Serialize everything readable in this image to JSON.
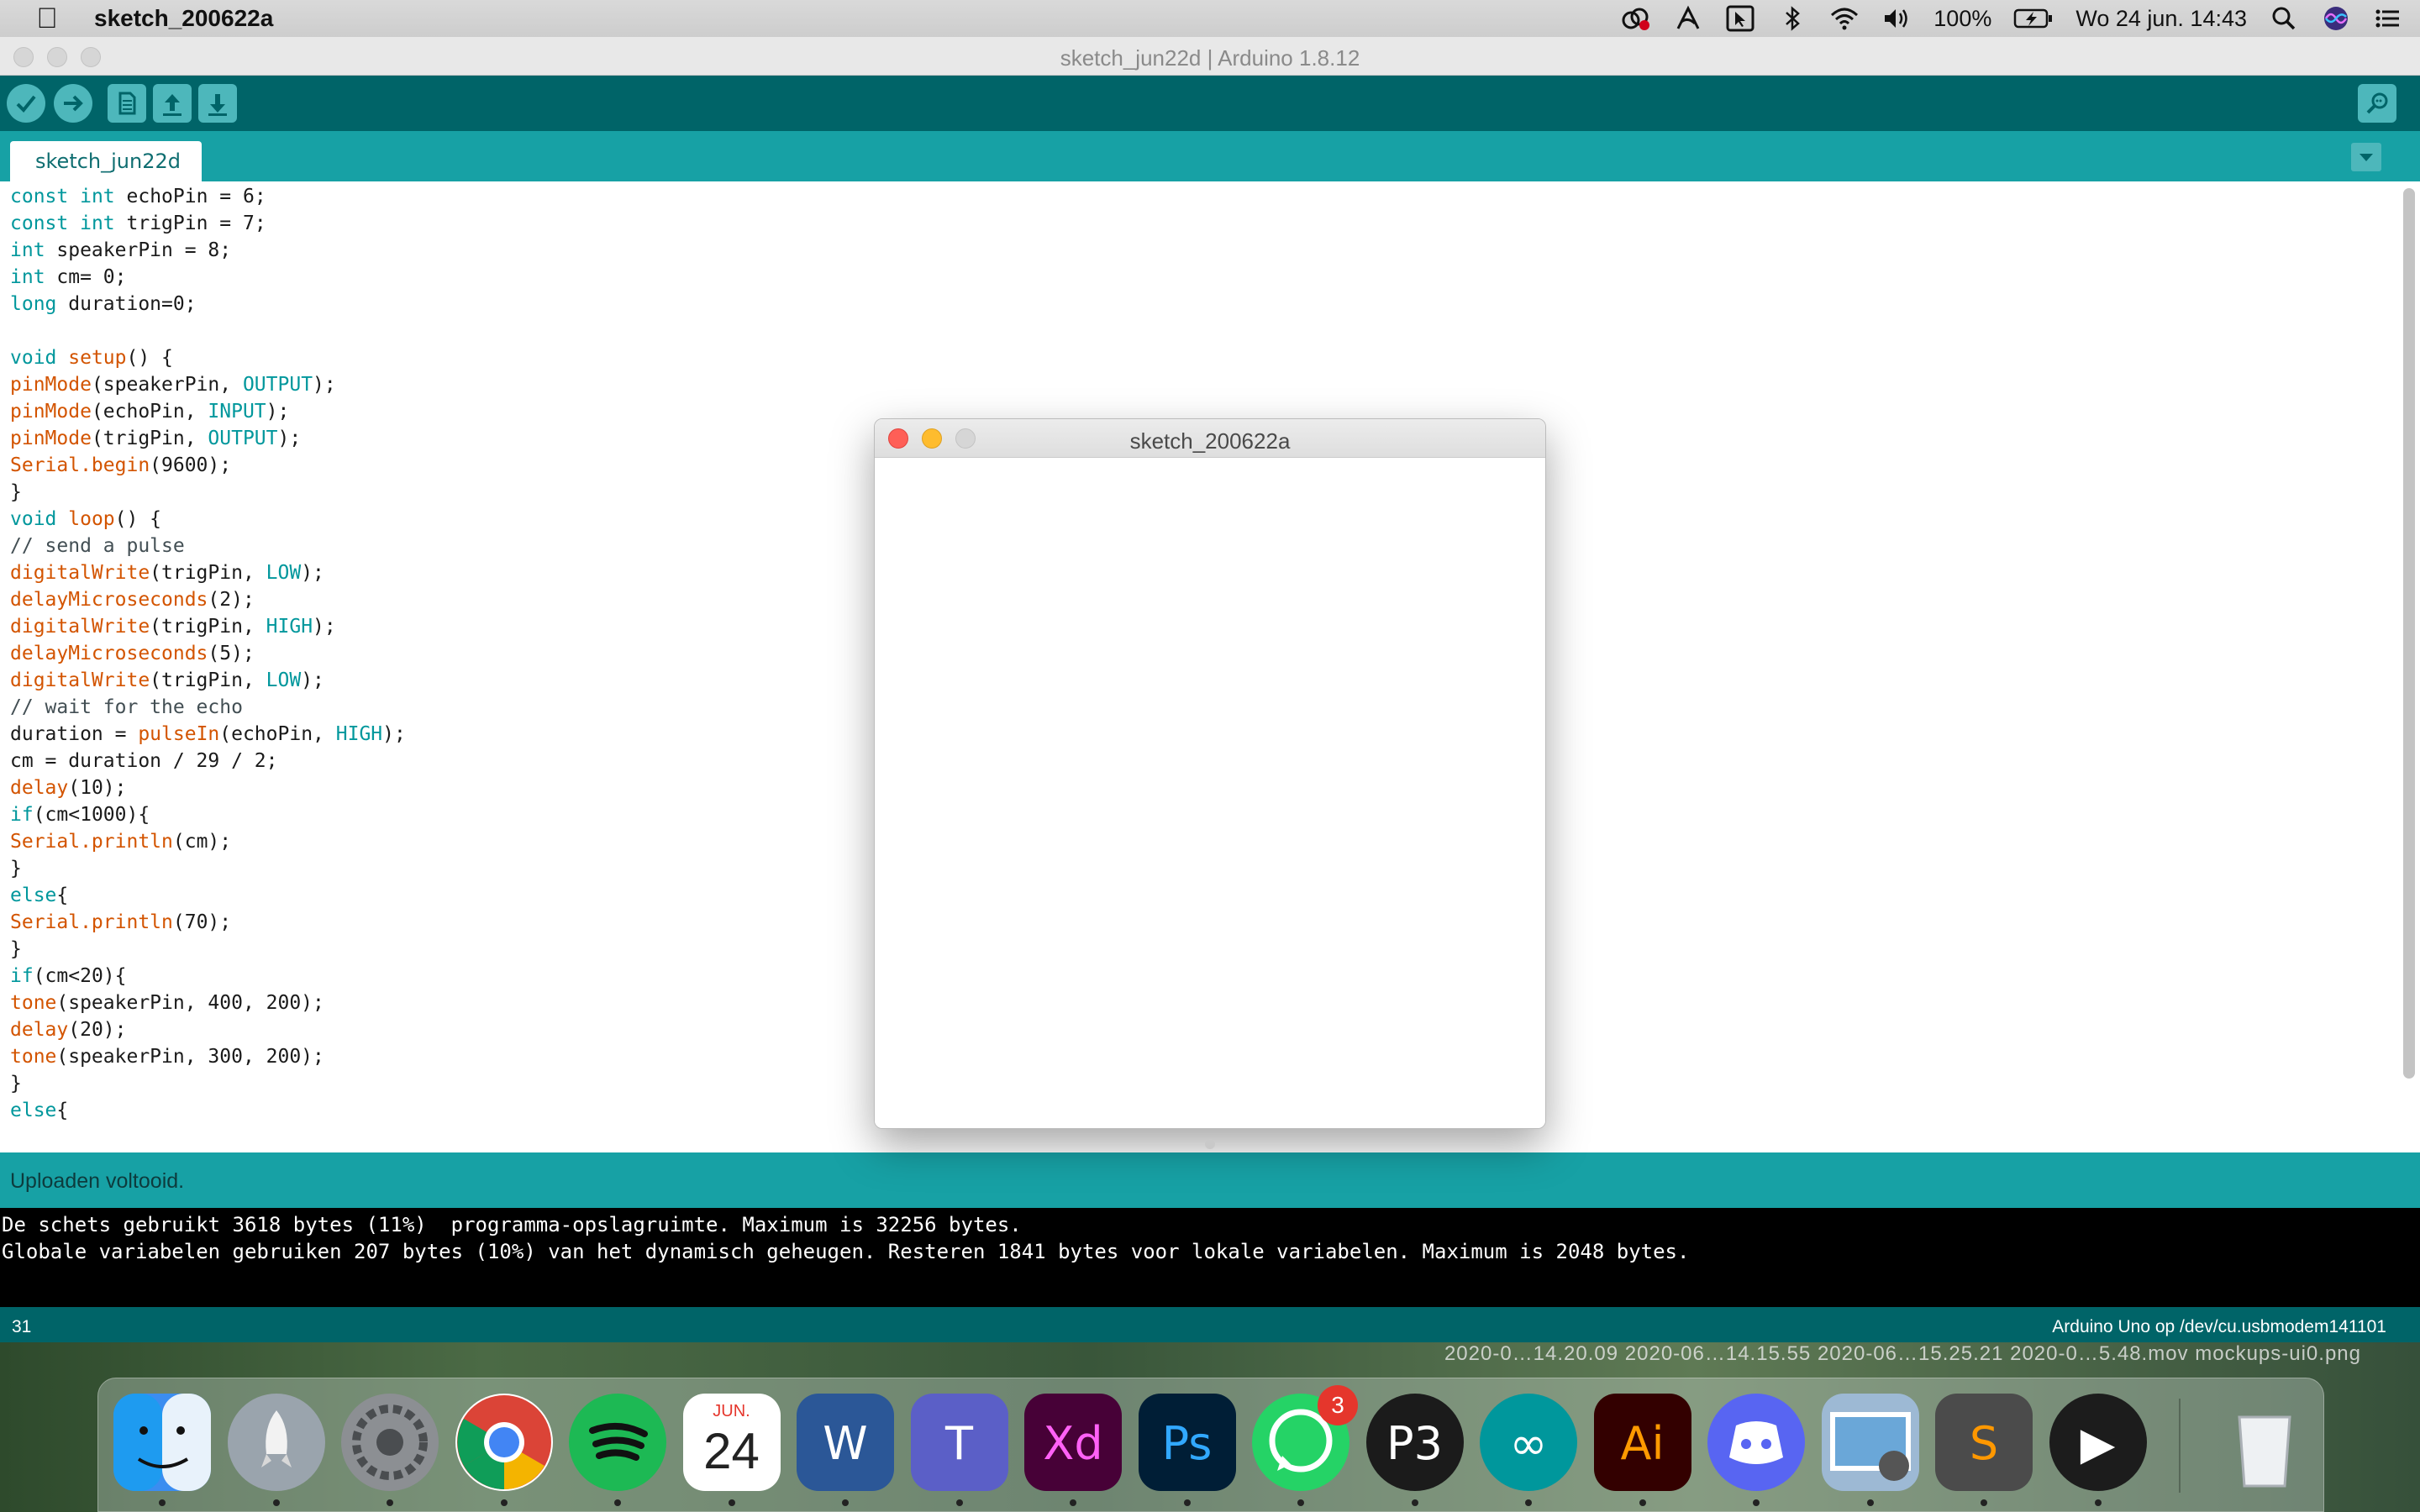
{
  "menubar": {
    "app_name": "sketch_200622a",
    "battery": "100%",
    "datetime": "Wo 24 jun. 14:43",
    "icons": [
      "creative-cloud-icon",
      "acrobat-icon",
      "cursor-icon",
      "bluetooth-icon",
      "wifi-icon",
      "volume-icon",
      "battery-icon",
      "search-icon",
      "siri-icon",
      "control-center-icon"
    ]
  },
  "window": {
    "title": "sketch_jun22d | Arduino 1.8.12",
    "toolbar": [
      "verify-button",
      "upload-button",
      "new-button",
      "open-button",
      "save-button",
      "serial-monitor-button"
    ],
    "tab": "sketch_jun22d",
    "status": "Uploaden voltooid.",
    "console": [
      "De schets gebruikt 3618 bytes (11%)  programma-opslagruimte. Maximum is 32256 bytes.",
      "Globale variabelen gebruiken 207 bytes (10%) van het dynamisch geheugen. Resteren 1841 bytes voor lokale variabelen. Maximum is 2048 bytes."
    ],
    "line_number": "31",
    "board": "Arduino Uno op /dev/cu.usbmodem141101"
  },
  "code": [
    "const int echoPin = 6;",
    "const int trigPin = 7;",
    "int speakerPin = 8;",
    "int cm= 0;",
    "long duration=0;",
    "",
    "void setup() {",
    "pinMode(speakerPin, OUTPUT);",
    "pinMode(echoPin, INPUT);",
    "pinMode(trigPin, OUTPUT);",
    "Serial.begin(9600);",
    "}",
    "void loop() {",
    "// send a pulse",
    "digitalWrite(trigPin, LOW);",
    "delayMicroseconds(2);",
    "digitalWrite(trigPin, HIGH);",
    "delayMicroseconds(5);",
    "digitalWrite(trigPin, LOW);",
    "// wait for the echo",
    "duration = pulseIn(echoPin, HIGH);",
    "cm = duration / 29 / 2;",
    "delay(10);",
    "if(cm<1000){",
    "Serial.println(cm);",
    "}",
    "else{",
    "Serial.println(70);",
    "}",
    "if(cm<20){",
    "tone(speakerPin, 400, 200);",
    "delay(20);",
    "tone(speakerPin, 300, 200);",
    "}",
    "else{"
  ],
  "sketch_window": {
    "title": "sketch_200622a"
  },
  "desktop_files": "2020-0…14.20.09   2020-06…14.15.55   2020-06…15.25.21   2020-0…5.48.mov   mockups-ui0.png",
  "dock": [
    {
      "name": "finder",
      "label": "",
      "color": "#3b8df0"
    },
    {
      "name": "launchpad",
      "label": "",
      "color": "#9aa4ad"
    },
    {
      "name": "system-preferences",
      "label": "",
      "color": "#8c8f93"
    },
    {
      "name": "chrome",
      "label": "",
      "color": "#ffffff"
    },
    {
      "name": "spotify",
      "label": "",
      "color": "#1db954"
    },
    {
      "name": "calendar",
      "label": "24",
      "month": "JUN.",
      "color": "#ffffff"
    },
    {
      "name": "word",
      "label": "W",
      "color": "#2b5797"
    },
    {
      "name": "teams",
      "label": "T",
      "color": "#5b5fc7"
    },
    {
      "name": "adobe-xd",
      "label": "Xd",
      "color": "#470137"
    },
    {
      "name": "photoshop",
      "label": "Ps",
      "color": "#001e36"
    },
    {
      "name": "whatsapp",
      "label": "",
      "color": "#25d366",
      "badge": "3"
    },
    {
      "name": "processing",
      "label": "P3",
      "color": "#1b1b1b"
    },
    {
      "name": "arduino",
      "label": "∞",
      "color": "#00979c"
    },
    {
      "name": "illustrator",
      "label": "Ai",
      "color": "#330000"
    },
    {
      "name": "discord",
      "label": "",
      "color": "#5865f2"
    },
    {
      "name": "preview",
      "label": "",
      "color": "#9db9d4"
    },
    {
      "name": "sublime-text",
      "label": "S",
      "color": "#4b4b4b"
    },
    {
      "name": "quicktime",
      "label": "▶",
      "color": "#1c1c1c"
    },
    {
      "name": "trash",
      "label": "",
      "color": "#d9dde0"
    }
  ]
}
